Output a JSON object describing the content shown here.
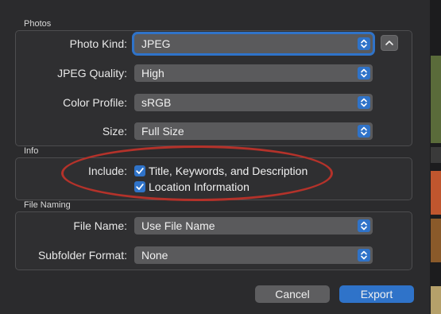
{
  "photos": {
    "section_label": "Photos",
    "photo_kind": {
      "label": "Photo Kind:",
      "value": "JPEG"
    },
    "jpeg_quality": {
      "label": "JPEG Quality:",
      "value": "High"
    },
    "color_profile": {
      "label": "Color Profile:",
      "value": "sRGB"
    },
    "size": {
      "label": "Size:",
      "value": "Full Size"
    }
  },
  "info": {
    "section_label": "Info",
    "include_label": "Include:",
    "options": [
      {
        "label": "Title, Keywords, and Description",
        "checked": true
      },
      {
        "label": "Location Information",
        "checked": true
      }
    ]
  },
  "file_naming": {
    "section_label": "File Naming",
    "file_name": {
      "label": "File Name:",
      "value": "Use File Name"
    },
    "subfolder_format": {
      "label": "Subfolder Format:",
      "value": "None"
    }
  },
  "buttons": {
    "cancel": "Cancel",
    "export": "Export"
  },
  "colors": {
    "accent": "#2f73c9",
    "annotation": "#b4322a"
  }
}
